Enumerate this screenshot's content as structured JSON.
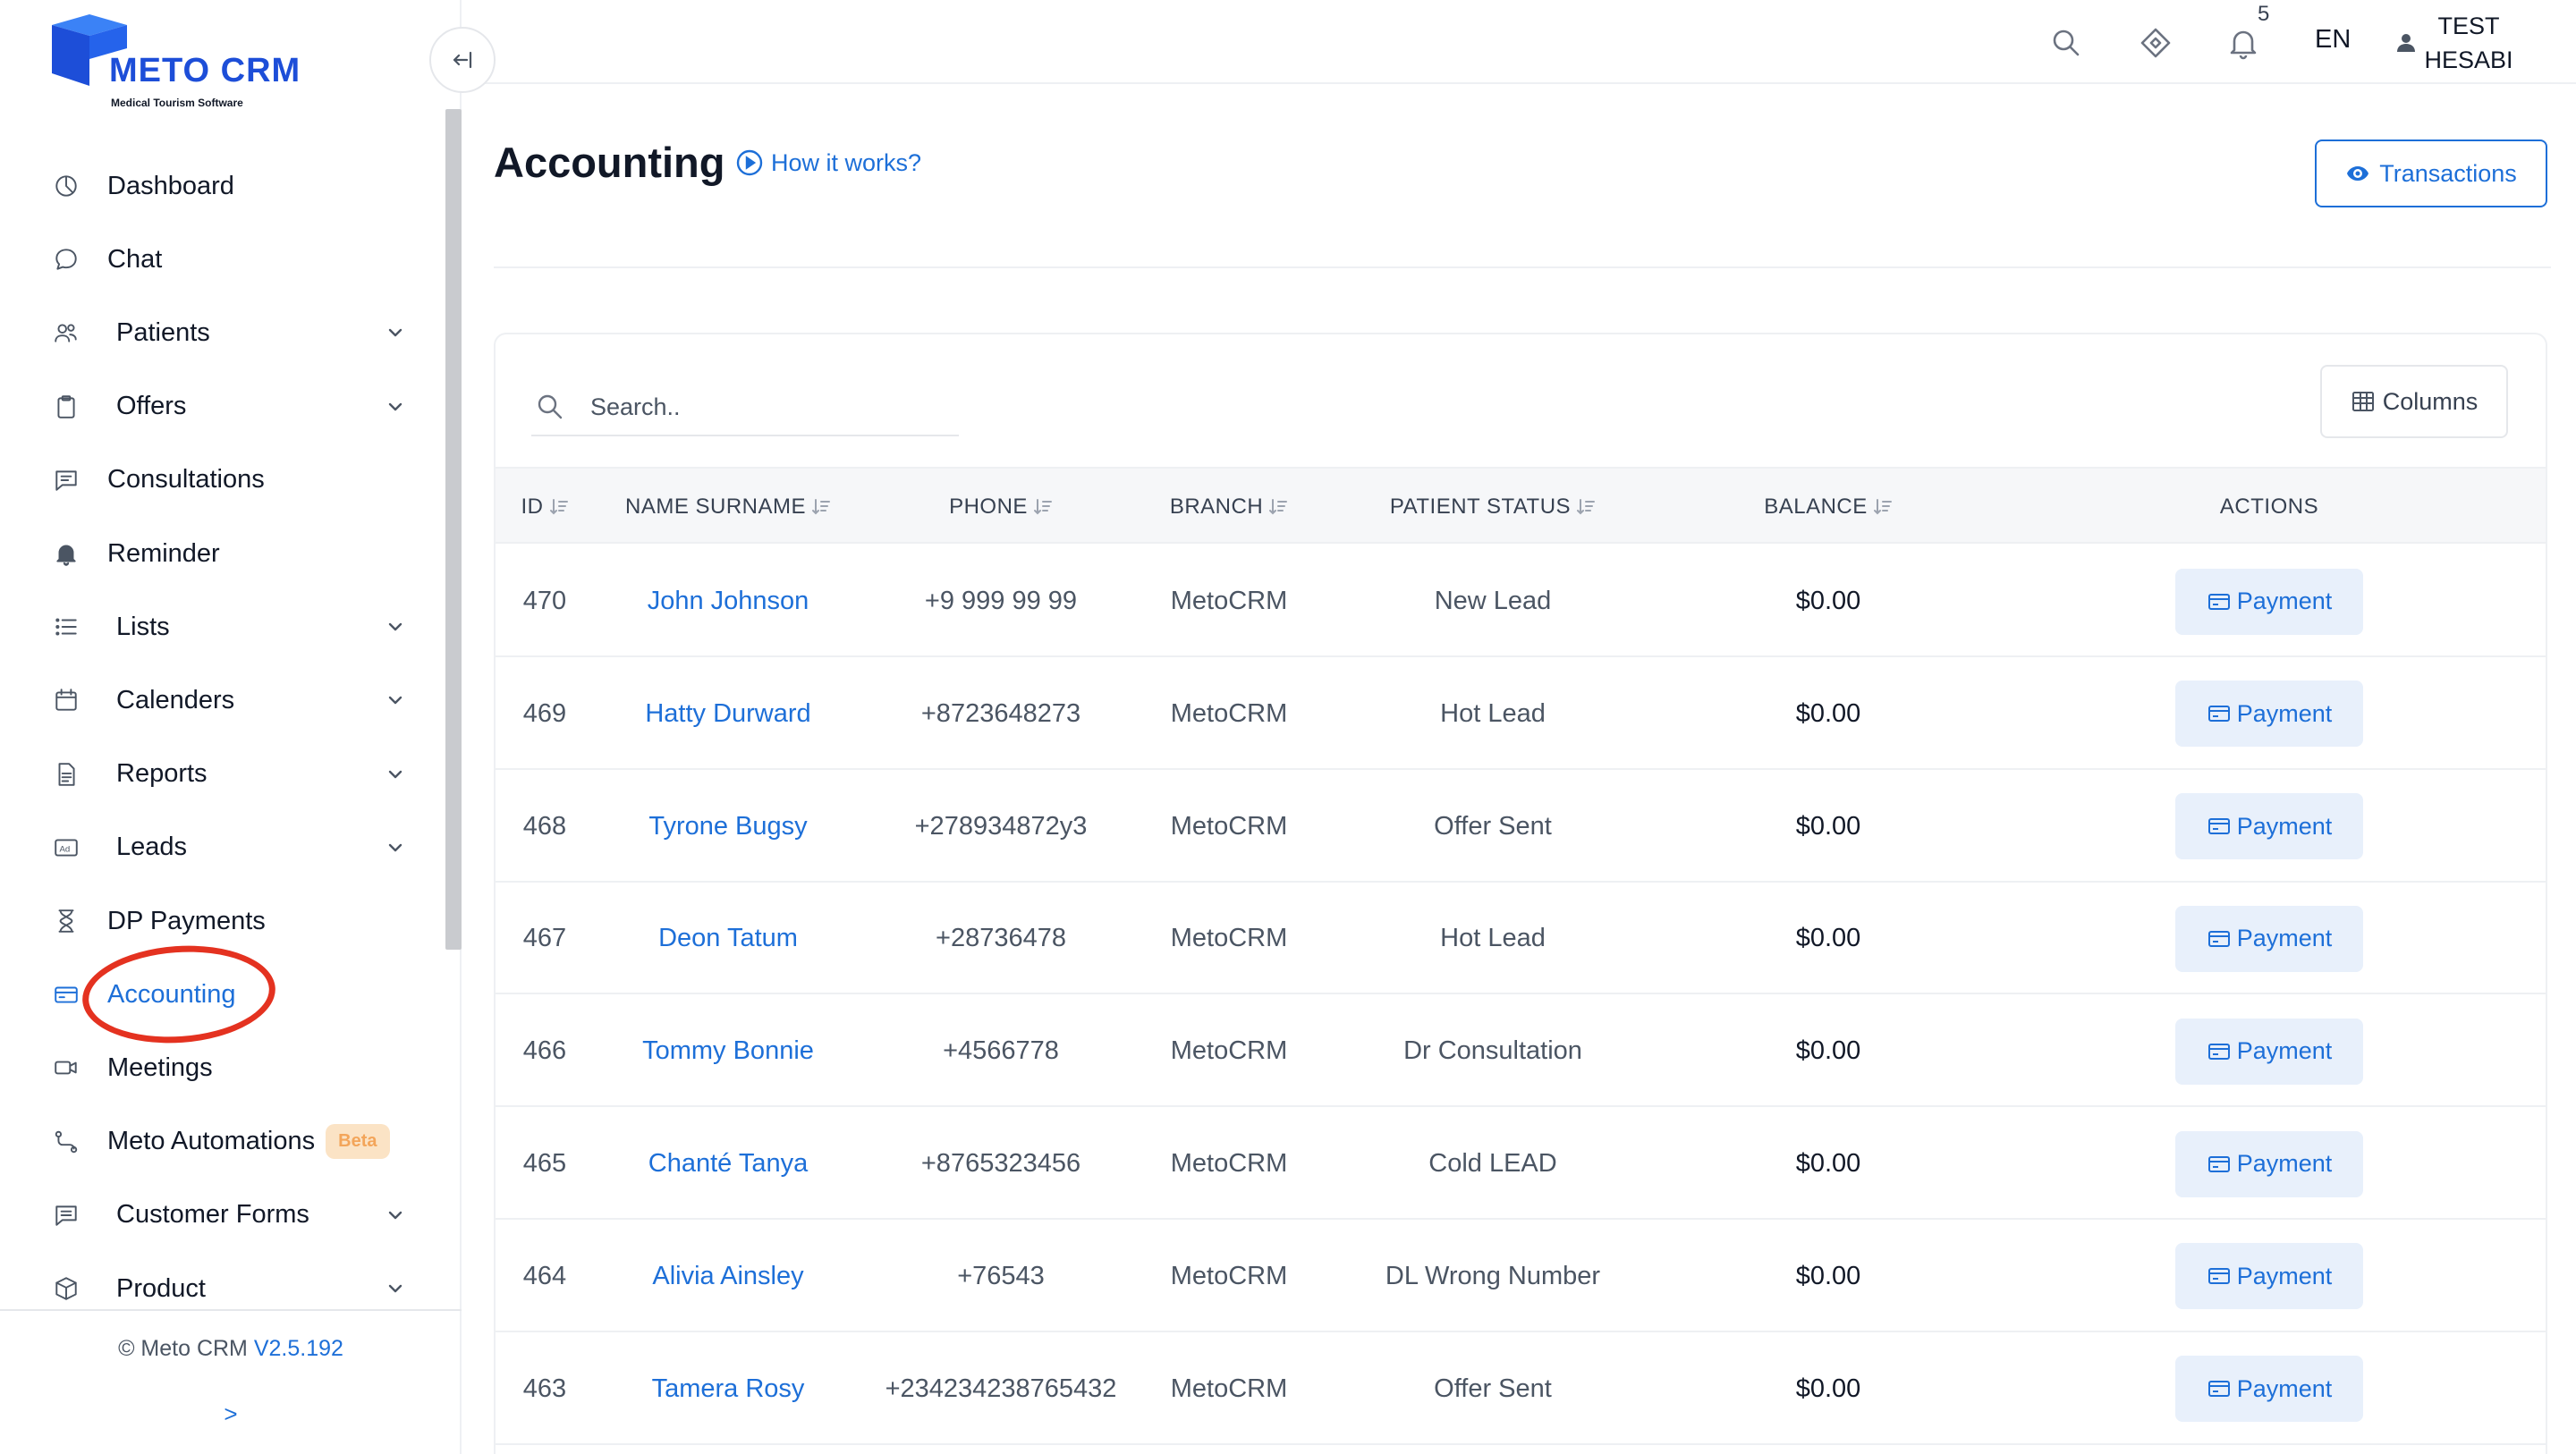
{
  "app": {
    "brand": "METO CRM",
    "tagline": "Medical Tourism Software"
  },
  "sidebar": {
    "items": [
      {
        "label": "Dashboard",
        "icon": "dashboard-icon",
        "has_submenu": false
      },
      {
        "label": "Chat",
        "icon": "chat-icon",
        "has_submenu": false
      },
      {
        "label": "Patients",
        "icon": "users-icon",
        "has_submenu": true
      },
      {
        "label": "Offers",
        "icon": "clipboard-icon",
        "has_submenu": true
      },
      {
        "label": "Consultations",
        "icon": "message-icon",
        "has_submenu": false
      },
      {
        "label": "Reminder",
        "icon": "bell-icon",
        "has_submenu": false
      },
      {
        "label": "Lists",
        "icon": "list-icon",
        "has_submenu": true
      },
      {
        "label": "Calenders",
        "icon": "calendar-icon",
        "has_submenu": true
      },
      {
        "label": "Reports",
        "icon": "document-icon",
        "has_submenu": true
      },
      {
        "label": "Leads",
        "icon": "ad-icon",
        "has_submenu": true
      },
      {
        "label": "DP Payments",
        "icon": "hourglass-icon",
        "has_submenu": false
      },
      {
        "label": "Accounting",
        "icon": "credit-card-icon",
        "has_submenu": false,
        "active": true
      },
      {
        "label": "Meetings",
        "icon": "video-icon",
        "has_submenu": false
      },
      {
        "label": "Meto Automations",
        "icon": "automation-icon",
        "has_submenu": false,
        "badge": "Beta"
      },
      {
        "label": "Customer Forms",
        "icon": "form-icon",
        "has_submenu": true
      },
      {
        "label": "Product",
        "icon": "box-icon",
        "has_submenu": true
      }
    ],
    "footer": {
      "copyright": "© Meto CRM",
      "version": "V2.5.192",
      "expand": ">"
    }
  },
  "header": {
    "notification_count": "5",
    "language": "EN",
    "user_name": "TEST HESABI"
  },
  "page": {
    "title": "Accounting",
    "how_it_works": "How it works?",
    "transactions_label": "Transactions"
  },
  "table": {
    "search_placeholder": "Search..",
    "columns_label": "Columns",
    "headers": {
      "id": "ID",
      "name": "NAME SURNAME",
      "phone": "PHONE",
      "branch": "BRANCH",
      "status": "PATIENT STATUS",
      "balance": "BALANCE",
      "actions": "ACTIONS"
    },
    "action_label": "Payment",
    "rows": [
      {
        "id": "470",
        "name": "John Johnson",
        "phone": "+9 999 99 99",
        "branch": "MetoCRM",
        "status": "New Lead",
        "balance": "$0.00"
      },
      {
        "id": "469",
        "name": "Hatty Durward",
        "phone": "+8723648273",
        "branch": "MetoCRM",
        "status": "Hot Lead",
        "balance": "$0.00"
      },
      {
        "id": "468",
        "name": "Tyrone Bugsy",
        "phone": "+278934872y3",
        "branch": "MetoCRM",
        "status": "Offer Sent",
        "balance": "$0.00"
      },
      {
        "id": "467",
        "name": "Deon Tatum",
        "phone": "+28736478",
        "branch": "MetoCRM",
        "status": "Hot Lead",
        "balance": "$0.00"
      },
      {
        "id": "466",
        "name": "Tommy Bonnie",
        "phone": "+4566778",
        "branch": "MetoCRM",
        "status": "Dr Consultation",
        "balance": "$0.00"
      },
      {
        "id": "465",
        "name": "Chanté Tanya",
        "phone": "+8765323456",
        "branch": "MetoCRM",
        "status": "Cold LEAD",
        "balance": "$0.00"
      },
      {
        "id": "464",
        "name": "Alivia Ainsley",
        "phone": "+76543",
        "branch": "MetoCRM",
        "status": "DL Wrong Number",
        "balance": "$0.00"
      },
      {
        "id": "463",
        "name": "Tamera Rosy",
        "phone": "+234234238765432",
        "branch": "MetoCRM",
        "status": "Offer Sent",
        "balance": "$0.00"
      }
    ]
  },
  "colors": {
    "accent": "#1d6fd8",
    "brand": "#1d4ed8",
    "highlight_ring": "#e43220",
    "beta_badge_bg": "#fbe3c5",
    "beta_badge_text": "#f3a55a"
  }
}
